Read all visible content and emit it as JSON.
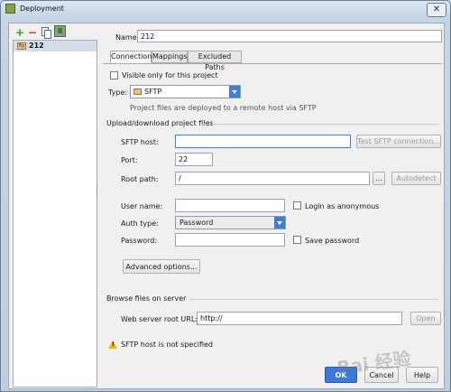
{
  "window": {
    "title": "Deployment",
    "close_glyph": "✕"
  },
  "toolbar": {
    "add_glyph": "+",
    "remove_glyph": "−"
  },
  "servers": [
    {
      "name": "212",
      "icon": "sftp-server-icon"
    }
  ],
  "form": {
    "name_label": "Name:",
    "name_value": "212",
    "tabs": [
      "Connection",
      "Mappings",
      "Excluded Paths"
    ],
    "active_tab": "Connection",
    "visible_only_label": "Visible only for this project",
    "type_label": "Type:",
    "type_value": "SFTP",
    "type_description": "Project files are deployed to a remote host via SFTP",
    "upload_section": "Upload/download project files",
    "sftp_host_label": "SFTP host:",
    "sftp_host_value": "",
    "test_button": "Test SFTP connection...",
    "port_label": "Port:",
    "port_value": "22",
    "root_path_label": "Root path:",
    "root_path_value": "/",
    "browse_button": "...",
    "autodetect_button": "Autodetect",
    "user_name_label": "User name:",
    "user_name_value": "",
    "login_anonymous_label": "Login as anonymous",
    "auth_type_label": "Auth type:",
    "auth_type_value": "Password",
    "password_label": "Password:",
    "password_value": "",
    "save_password_label": "Save password",
    "advanced_button": "Advanced options...",
    "browse_section": "Browse files on server",
    "web_root_label": "Web server root URL:",
    "web_root_value": "http://",
    "open_button": "Open",
    "warning_text": "SFTP host is not specified"
  },
  "footer": {
    "ok": "OK",
    "cancel": "Cancel",
    "help": "Help"
  },
  "watermark": "Bai 经验",
  "colors": {
    "accent": "#3f7fd4",
    "warning": "#f0b400",
    "add": "#2e9a2e",
    "remove": "#c42b2b"
  }
}
